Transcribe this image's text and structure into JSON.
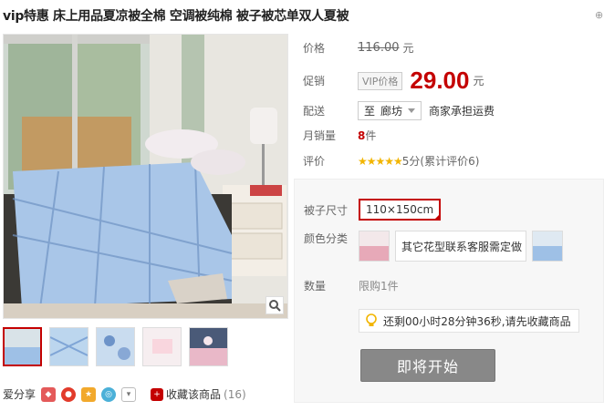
{
  "product": {
    "title": "vip特惠 床上用品夏凉被全棉 空调被纯棉 被子被芯单双人夏被"
  },
  "pricing": {
    "price_label": "价格",
    "original_price": "116.00",
    "yuan": "元",
    "promo_label": "促销",
    "vip_badge": "VIP价格",
    "promo_price": "29.00",
    "promo_yuan": "元"
  },
  "shipping": {
    "label": "配送",
    "to": "至",
    "location": "廊坊",
    "note": "商家承担运费"
  },
  "sales": {
    "label": "月销量",
    "count": "8",
    "unit": "件"
  },
  "rating": {
    "label": "评价",
    "stars": "★★★★★",
    "score_text": "5分(累计评价6)",
    "value": 5
  },
  "sku": {
    "size_label": "被子尺寸",
    "size_value": "110×150cm",
    "color_label": "颜色分类",
    "color_text_option": "其它花型联系客服需定做",
    "qty_label": "数量",
    "qty_value": "限购1件",
    "countdown_tip": "还剩00小时28分钟36秒,请先收藏商品",
    "buy_button": "即将开始"
  },
  "share": {
    "label": "爱分享",
    "collect_label": "收藏该商品",
    "collect_count": "(16)"
  },
  "colors": {
    "accent": "#c40000",
    "star": "#f2b500",
    "button": "#888888"
  }
}
